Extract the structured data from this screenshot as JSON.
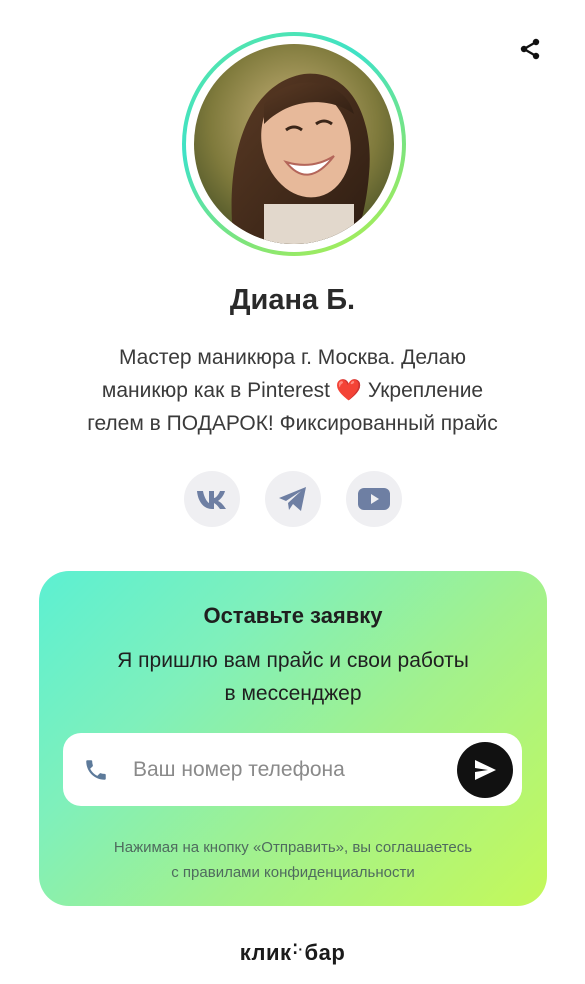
{
  "header": {
    "share_icon": "share-icon"
  },
  "profile": {
    "avatar_icon": "avatar-photo",
    "name": "Диана Б.",
    "bio_lines": [
      "Мастер маникюра г. Москва. Делаю",
      "маникюр как в Pinterest",
      "Укрепление",
      "гелем в ПОДАРОК! Фиксированный прайс"
    ],
    "bio_emoji": "❤️"
  },
  "socials": [
    {
      "name": "vk",
      "icon": "vk-icon"
    },
    {
      "name": "telegram",
      "icon": "telegram-icon"
    },
    {
      "name": "youtube",
      "icon": "youtube-icon"
    }
  ],
  "form": {
    "title": "Оставьте заявку",
    "subtitle_lines": [
      "Я пришлю вам прайс и свои работы",
      "в мессенджер"
    ],
    "phone_placeholder": "Ваш номер телефона",
    "phone_value": "",
    "phone_icon": "phone-icon",
    "send_icon": "send-icon",
    "consent_lines": [
      "Нажимая на кнопку «Отправить», вы соглашаетесь",
      "с правилами конфиденциальности"
    ]
  },
  "footer": {
    "brand_left": "клик",
    "brand_right": "бар"
  },
  "colors": {
    "accent_dark": "#111111",
    "icon_gray": "#6e7fa3",
    "card_gradient_start": "#5cf0d2",
    "card_gradient_end": "#c4f95a",
    "ring_gradient_start": "#3fe2c6",
    "ring_gradient_end": "#b9f24a"
  }
}
